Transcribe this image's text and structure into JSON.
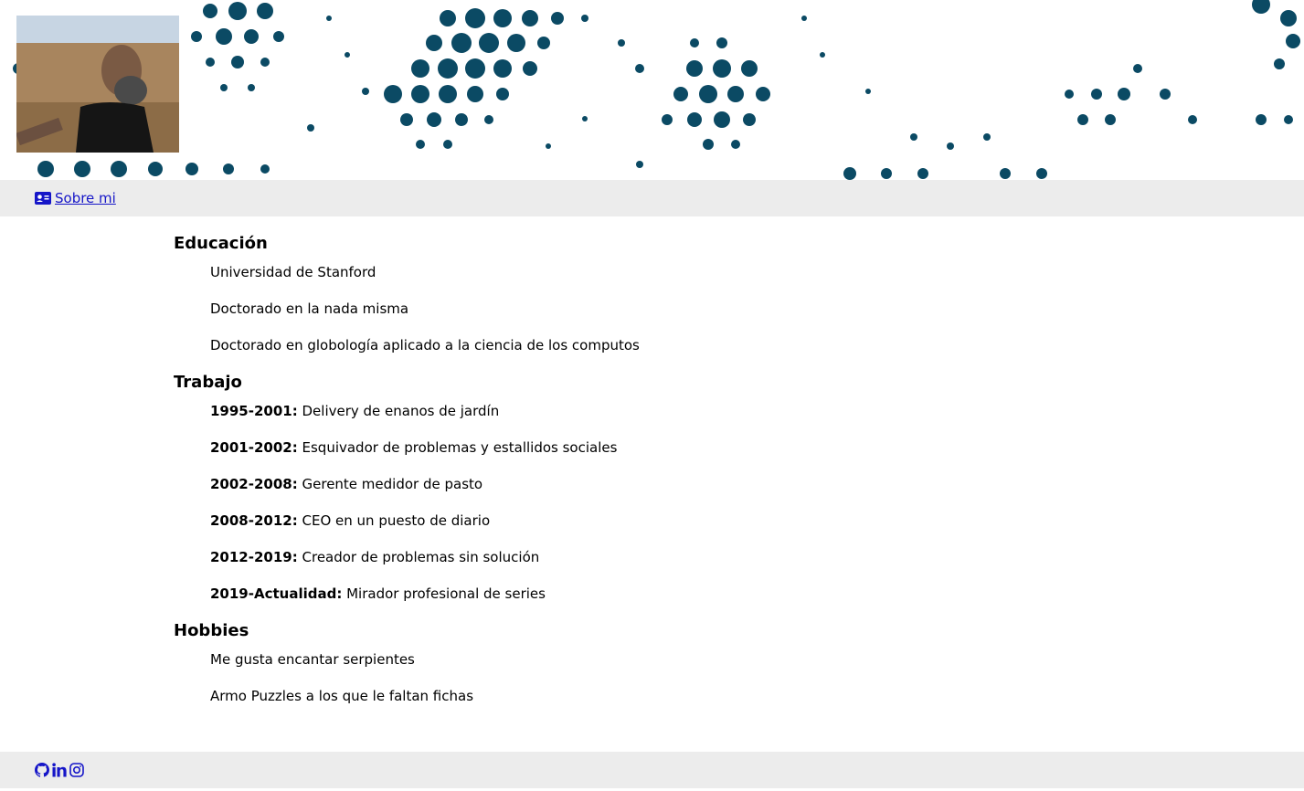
{
  "nav": {
    "about_label": "Sobre mi"
  },
  "sections": {
    "education": {
      "title": "Educación",
      "items": [
        "Universidad de Stanford",
        "Doctorado en la nada misma",
        "Doctorado en globología aplicado a la ciencia de los computos"
      ]
    },
    "work": {
      "title": "Trabajo",
      "items": [
        {
          "period": "1995-2001:",
          "text": " Delivery de enanos de jardín"
        },
        {
          "period": "2001-2002:",
          "text": " Esquivador de problemas y estallidos sociales"
        },
        {
          "period": "2002-2008:",
          "text": " Gerente medidor de pasto"
        },
        {
          "period": "2008-2012:",
          "text": " CEO en un puesto de diario"
        },
        {
          "period": "2012-2019:",
          "text": " Creador de problemas sin solución"
        },
        {
          "period": "2019-Actualidad:",
          "text": " Mirador profesional de series"
        }
      ]
    },
    "hobbies": {
      "title": "Hobbies",
      "items": [
        "Me gusta encantar serpientes",
        "Armo Puzzles a los que le faltan fichas"
      ]
    }
  },
  "footer": {
    "icons": [
      "github-icon",
      "linkedin-icon",
      "instagram-icon"
    ]
  },
  "colors": {
    "link": "#1515c8",
    "bar_bg": "#ececec",
    "dots": "#0b4a64"
  }
}
